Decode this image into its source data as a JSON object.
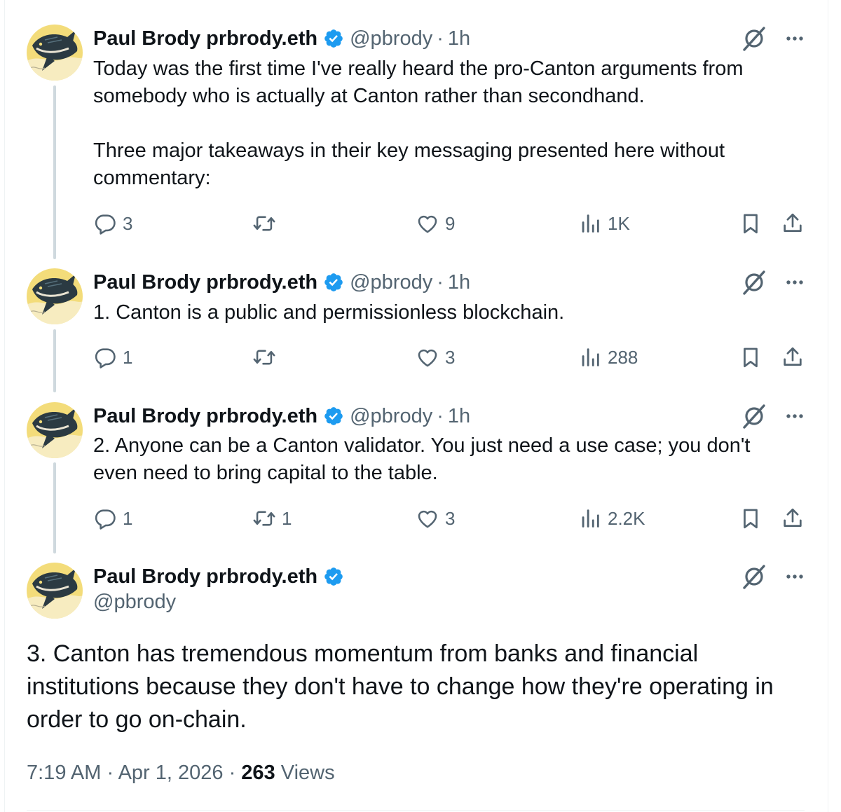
{
  "colors": {
    "text": "#0f1419",
    "secondary": "#536471",
    "verified": "#1d9bf0",
    "thread_line": "#cfd9de",
    "avatar_bg": "#f3dc7a"
  },
  "author": {
    "name": "Paul Brody prbrody.eth",
    "handle": "@pbrody"
  },
  "icons": {
    "verified": "verified-badge-icon",
    "grok": "grok-icon",
    "more": "more-icon",
    "reply": "reply-icon",
    "retweet": "retweet-icon",
    "like": "like-icon",
    "views": "views-icon",
    "bookmark": "bookmark-icon",
    "share": "share-icon"
  },
  "tweets": [
    {
      "time": "1h",
      "text": "Today was the first time I've really heard the pro-Canton arguments from somebody who is actually at Canton rather than secondhand.\n\nThree major takeaways in their key messaging presented here without commentary:",
      "replies": "3",
      "retweets": "",
      "likes": "9",
      "views": "1K"
    },
    {
      "time": "1h",
      "text": "1. Canton is a public and permissionless blockchain.",
      "replies": "1",
      "retweets": "",
      "likes": "3",
      "views": "288"
    },
    {
      "time": "1h",
      "text": "2. Anyone can be a Canton validator. You just need a use case; you don't even need to bring capital to the table.",
      "replies": "1",
      "retweets": "1",
      "likes": "3",
      "views": "2.2K"
    }
  ],
  "main_tweet": {
    "text": "3. Canton has tremendous momentum from banks and financial institutions because they don't have to change how they're operating in order to go on-chain.",
    "timestamp": "7:19 AM · Apr 1, 2026 · ",
    "views_count": "263",
    "views_label": " Views"
  }
}
